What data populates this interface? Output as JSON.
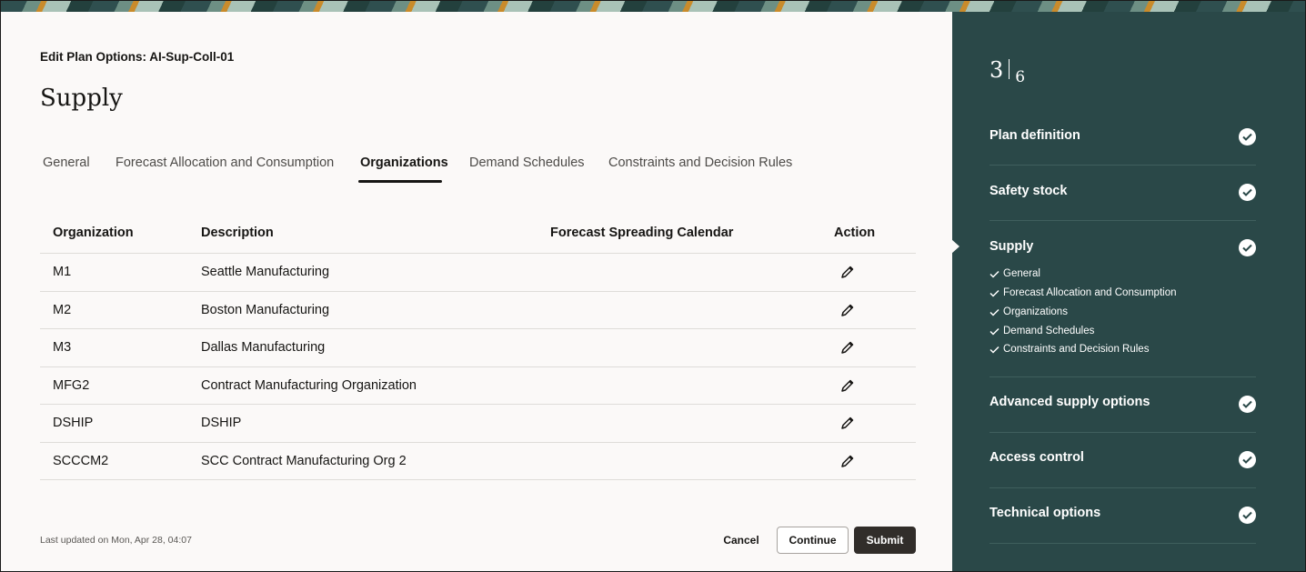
{
  "header": {
    "breadcrumb": "Edit Plan Options: AI-Sup-Coll-01",
    "title": "Supply"
  },
  "tabs": [
    {
      "label": "General",
      "active": false
    },
    {
      "label": "Forecast Allocation and Consumption",
      "active": false
    },
    {
      "label": "Organizations",
      "active": true
    },
    {
      "label": "Demand Schedules",
      "active": false
    },
    {
      "label": "Constraints and Decision Rules",
      "active": false
    }
  ],
  "table": {
    "columns": [
      "Organization",
      "Description",
      "Forecast Spreading Calendar",
      "Action"
    ],
    "rows": [
      {
        "organization": "M1",
        "description": "Seattle Manufacturing",
        "calendar": "",
        "action_icon": "edit-icon"
      },
      {
        "organization": "M2",
        "description": "Boston Manufacturing",
        "calendar": "",
        "action_icon": "edit-icon"
      },
      {
        "organization": "M3",
        "description": "Dallas Manufacturing",
        "calendar": "",
        "action_icon": "edit-icon"
      },
      {
        "organization": "MFG2",
        "description": "Contract Manufacturing Organization",
        "calendar": "",
        "action_icon": "edit-icon"
      },
      {
        "organization": "DSHIP",
        "description": "DSHIP",
        "calendar": "",
        "action_icon": "edit-icon"
      },
      {
        "organization": "SCCCM2",
        "description": "SCC Contract Manufacturing Org 2",
        "calendar": "",
        "action_icon": "edit-icon"
      }
    ]
  },
  "footer": {
    "last_updated": "Last updated on Mon, Apr 28, 04:07",
    "cancel_label": "Cancel",
    "continue_label": "Continue",
    "submit_label": "Submit"
  },
  "sidebar": {
    "current_step": "3",
    "total_steps": "6",
    "steps": [
      {
        "label": "Plan definition",
        "complete": true
      },
      {
        "label": "Safety stock",
        "complete": true
      },
      {
        "label": "Supply",
        "complete": true,
        "current": true,
        "substeps": [
          "General",
          "Forecast Allocation and Consumption",
          "Organizations",
          "Demand Schedules",
          "Constraints and Decision Rules"
        ]
      },
      {
        "label": "Advanced supply options",
        "complete": true
      },
      {
        "label": "Access control",
        "complete": true
      },
      {
        "label": "Technical options",
        "complete": true
      }
    ]
  },
  "colors": {
    "sidebar_bg": "#2a4848",
    "main_bg": "#fbf9f8",
    "primary_button": "#312d2a"
  }
}
